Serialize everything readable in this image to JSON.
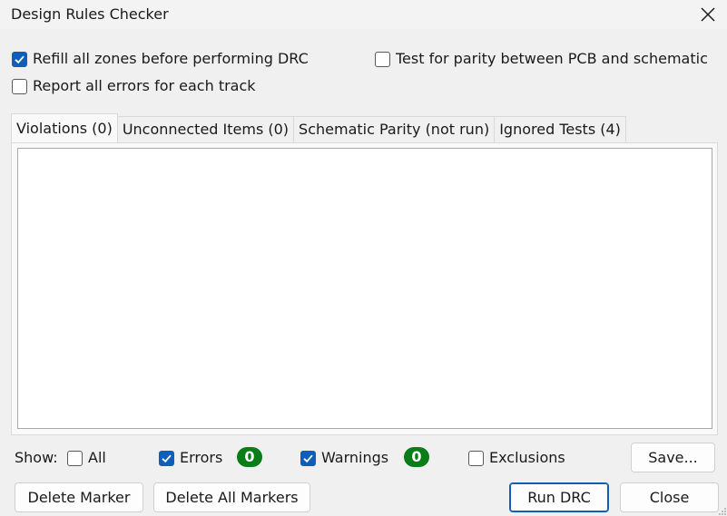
{
  "window": {
    "title": "Design Rules Checker"
  },
  "options": {
    "refill_zones": {
      "label": "Refill all zones before performing DRC",
      "checked": true
    },
    "test_parity": {
      "label": "Test for parity between PCB and schematic",
      "checked": false
    },
    "report_all_errors": {
      "label": "Report all errors for each track",
      "checked": false
    }
  },
  "tabs": [
    {
      "label": "Violations (0)",
      "active": true
    },
    {
      "label": "Unconnected Items (0)",
      "active": false
    },
    {
      "label": "Schematic Parity (not run)",
      "active": false
    },
    {
      "label": "Ignored Tests (4)",
      "active": false
    }
  ],
  "filters": {
    "show_label": "Show:",
    "all": {
      "label": "All",
      "checked": false
    },
    "errors": {
      "label": "Errors",
      "checked": true,
      "count": "0"
    },
    "warnings": {
      "label": "Warnings",
      "checked": true,
      "count": "0"
    },
    "exclusions": {
      "label": "Exclusions",
      "checked": false
    }
  },
  "buttons": {
    "save": "Save...",
    "delete_marker": "Delete Marker",
    "delete_all_markers": "Delete All Markers",
    "run_drc": "Run DRC",
    "close": "Close"
  },
  "icons": {
    "close": "close-icon",
    "checkmark": "checkmark-icon",
    "resize": "resize-grip-icon"
  },
  "colors": {
    "accent": "#0f5fb8",
    "badge_green": "#0b7d18"
  }
}
